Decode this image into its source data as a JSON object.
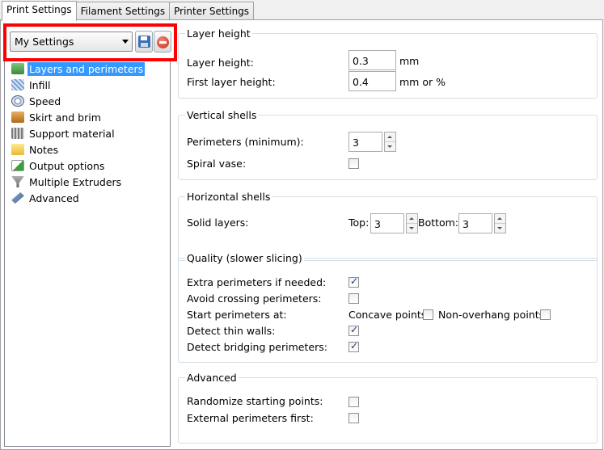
{
  "tabs": [
    {
      "label": "Print Settings",
      "active": true
    },
    {
      "label": "Filament Settings",
      "active": false
    },
    {
      "label": "Printer Settings",
      "active": false
    }
  ],
  "preset": {
    "selected": "My Settings"
  },
  "tree": [
    {
      "label": "Layers and perimeters",
      "icon": "layers-icon",
      "selected": true
    },
    {
      "label": "Infill",
      "icon": "infill-icon"
    },
    {
      "label": "Speed",
      "icon": "speed-icon"
    },
    {
      "label": "Skirt and brim",
      "icon": "skirt-icon"
    },
    {
      "label": "Support material",
      "icon": "support-icon"
    },
    {
      "label": "Notes",
      "icon": "notes-icon"
    },
    {
      "label": "Output options",
      "icon": "output-icon"
    },
    {
      "label": "Multiple Extruders",
      "icon": "extruders-icon"
    },
    {
      "label": "Advanced",
      "icon": "wrench-icon"
    }
  ],
  "layer_height": {
    "title": "Layer height",
    "layer_height_label": "Layer height:",
    "layer_height_value": "0.3",
    "layer_height_unit": "mm",
    "first_layer_label": "First layer height:",
    "first_layer_value": "0.4",
    "first_layer_unit": "mm or %"
  },
  "vertical_shells": {
    "title": "Vertical shells",
    "perimeters_label": "Perimeters (minimum):",
    "perimeters_value": "3",
    "spiral_vase_label": "Spiral vase:",
    "spiral_vase_checked": false
  },
  "horizontal_shells": {
    "title": "Horizontal shells",
    "solid_layers_label": "Solid layers:",
    "top_label": "Top:",
    "top_value": "3",
    "bottom_label": "Bottom:",
    "bottom_value": "3"
  },
  "quality": {
    "title": "Quality (slower slicing)",
    "extra_perimeters_label": "Extra perimeters if needed:",
    "extra_perimeters_checked": true,
    "avoid_crossing_label": "Avoid crossing perimeters:",
    "avoid_crossing_checked": false,
    "start_perimeters_label": "Start perimeters at:",
    "concave_label": "Concave points:",
    "concave_checked": false,
    "non_overhang_label": "Non-overhang points:",
    "non_overhang_checked": false,
    "thin_walls_label": "Detect thin walls:",
    "thin_walls_checked": true,
    "bridging_label": "Detect bridging perimeters:",
    "bridging_checked": true
  },
  "advanced": {
    "title": "Advanced",
    "randomize_label": "Randomize starting points:",
    "randomize_checked": false,
    "external_first_label": "External perimeters first:",
    "external_first_checked": false
  },
  "colors": {
    "highlight": "#ff0000",
    "selection": "#3399ff"
  }
}
